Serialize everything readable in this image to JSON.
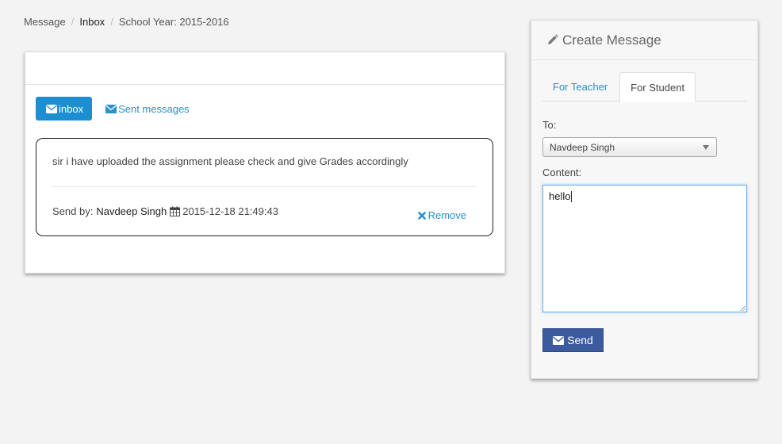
{
  "breadcrumb": {
    "items": [
      "Message",
      "Inbox",
      "School Year: 2015-2016"
    ]
  },
  "inbox_panel": {
    "tabs": {
      "inbox_label": "inbox",
      "sent_label": "Sent messages"
    },
    "messages": [
      {
        "text": "sir i have uploaded the assignment please check and give Grades accordingly",
        "send_by_label": "Send by:",
        "sender": "Navdeep Singh",
        "timestamp": "2015-12-18 21:49:43",
        "remove_label": "Remove"
      }
    ]
  },
  "create_panel": {
    "title": "Create Message",
    "tabs": [
      "For Teacher",
      "For Student"
    ],
    "active_tab": "For Student",
    "to_label": "To:",
    "to_value": "Navdeep Singh",
    "content_label": "Content:",
    "content_value": "hello",
    "send_label": "Send"
  },
  "colors": {
    "primary": "#1b8fd2",
    "link": "#2b8fc8",
    "send_button": "#3b5b9e",
    "background": "#f3f3f3"
  },
  "icons": {
    "inbox_button": "envelope-icon",
    "sent_link": "envelope-icon",
    "timestamp": "calendar-icon",
    "remove": "x-icon",
    "panel_title": "pencil-icon",
    "send_button": "envelope-icon"
  }
}
